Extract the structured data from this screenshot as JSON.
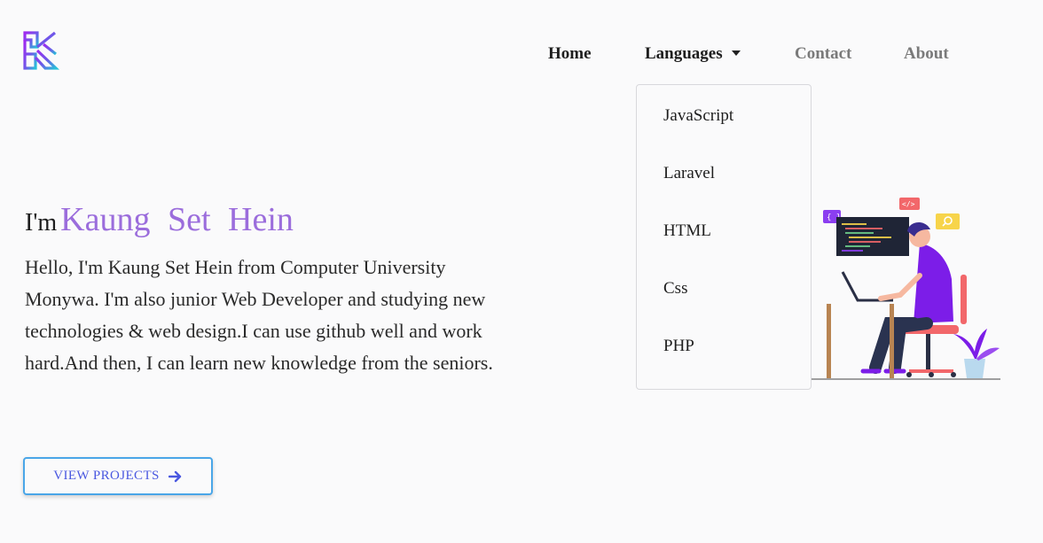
{
  "nav": {
    "home": "Home",
    "languages": "Languages",
    "contact": "Contact",
    "about": "About"
  },
  "dropdown": {
    "items": [
      "JavaScript",
      "Laravel",
      "HTML",
      "Css",
      "PHP"
    ]
  },
  "hero": {
    "greeting": "I'm",
    "name": "Kaung Set Hein",
    "description": "Hello, I'm Kaung Set Hein from Computer University Monywa. I'm also junior Web Developer and studying new technologies & web design.I can use github well and work hard.And then, I can learn new knowledge from the seniors.",
    "button_label": "VIEW PROJECTS"
  },
  "icons": {
    "logo": "logo-k-icon",
    "caret": "caret-down-icon",
    "arrow": "arrow-right-icon"
  },
  "colors": {
    "accent_name": "#9b6ddc",
    "button_border": "#4aa6e8",
    "button_text": "#4a58e0"
  }
}
